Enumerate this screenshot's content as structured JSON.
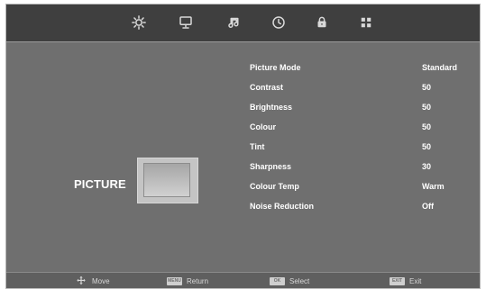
{
  "menu": {
    "section_title": "PICTURE",
    "settings": [
      {
        "label": "Picture Mode",
        "value": "Standard"
      },
      {
        "label": "Contrast",
        "value": "50"
      },
      {
        "label": "Brightness",
        "value": "50"
      },
      {
        "label": "Colour",
        "value": "50"
      },
      {
        "label": "Tint",
        "value": "50"
      },
      {
        "label": "Sharpness",
        "value": "30"
      },
      {
        "label": "Colour Temp",
        "value": "Warm"
      },
      {
        "label": "Noise Reduction",
        "value": "Off"
      }
    ]
  },
  "top_tabs": [
    {
      "icon": "gear-icon",
      "active": true
    },
    {
      "icon": "monitor-icon",
      "active": false
    },
    {
      "icon": "music-note-icon",
      "active": false
    },
    {
      "icon": "clock-icon",
      "active": false
    },
    {
      "icon": "lock-icon",
      "active": false
    },
    {
      "icon": "grid-icon",
      "active": false
    }
  ],
  "footer": {
    "move": "Move",
    "return": "Return",
    "select": "Select",
    "exit": "Exit",
    "menu_badge": "MENU",
    "ok_badge": "OK",
    "exit_badge": "EXIT"
  },
  "colors": {
    "background": "#6f6f6f",
    "topbar": "#3f3f3f",
    "text": "#ffffff",
    "footer_text": "#d9d9d9"
  }
}
